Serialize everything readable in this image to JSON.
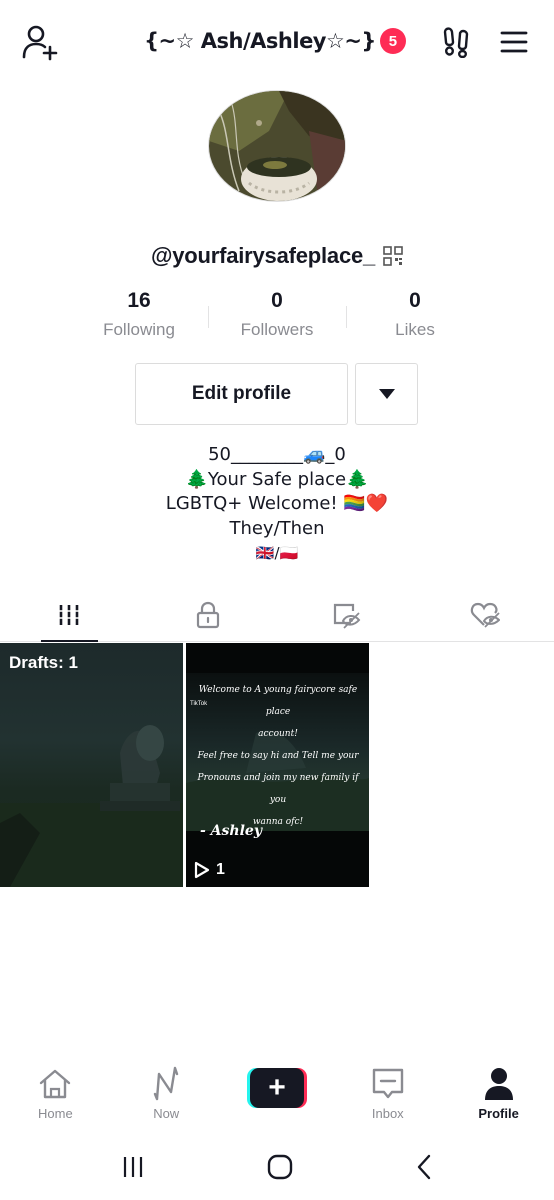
{
  "header": {
    "title": "{~☆ Ash/Ashley☆~}",
    "badge_count": "5",
    "icons": [
      "add-user-icon",
      "footprints-icon",
      "menu-icon"
    ]
  },
  "profile": {
    "username": "@yourfairysafeplace_",
    "stats": [
      {
        "value": "16",
        "label": "Following"
      },
      {
        "value": "0",
        "label": "Followers"
      },
      {
        "value": "0",
        "label": "Likes"
      }
    ],
    "edit_label": "Edit profile",
    "bio": [
      "50________🚙_0",
      "🌲Your Safe place🌲",
      "LGBTQ+ Welcome! 🏳️‍🌈❤️",
      "They/Then",
      "🇬🇧/🇵🇱"
    ]
  },
  "tabs": [
    "videos-grid-icon",
    "lock-icon",
    "eye-tag-icon",
    "heart-eye-icon"
  ],
  "videos": {
    "drafts_label": "Drafts: 1",
    "video2_text": [
      "Welcome to A young fairycore safe place",
      "account!",
      "Feel free to say hi and Tell me your",
      "Pronouns and join my new family if you",
      "wanna ofc!"
    ],
    "video2_watermark": "TikTok",
    "video2_signature": "- Ashley",
    "video2_plays": "1"
  },
  "bottom_nav": {
    "home": "Home",
    "now": "Now",
    "inbox": "Inbox",
    "profile": "Profile",
    "create": "+"
  },
  "colors": {
    "accent": "#fe2c55",
    "cyan": "#25f4ee",
    "text": "#161823",
    "muted": "#8a8b91"
  }
}
